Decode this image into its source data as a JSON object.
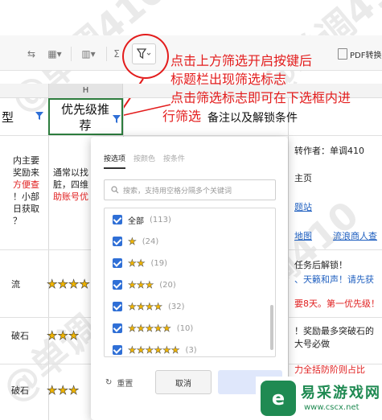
{
  "toolbar": {
    "sigma_label": "Σ",
    "pdf_label": "PDF转换",
    "filter_icon": "filter-funnel-icon"
  },
  "sheet": {
    "column_letter": "H",
    "header_type": "型",
    "header_priority": "优先级推荐",
    "header_notes": "备注以及解锁条件",
    "col_g_rows": [
      "内主要",
      "奖励来",
      "方便查",
      "！小部",
      "日获取",
      "？"
    ],
    "col_h_text": "通常以找",
    "col_h_text2": "脏，四维",
    "col_h_text3": "助账号优",
    "left_labels": [
      "流",
      "破石",
      "破石"
    ],
    "right_author": "转作者：单调410",
    "right_home": "主页",
    "right_site": "题站",
    "right_map": "地图",
    "right_trader": "流浪商人查",
    "right_task": "任务后解锁！",
    "right_tianji": "、天籁和声！请先获",
    "right_ba": "要8天。第一优先级！",
    "right_reward": "！奖励最多突破石的",
    "right_bighao": "大号必做",
    "right_bottom": "力全括防阶则占比"
  },
  "annotation": {
    "line1": "点击上方筛选开启按键后",
    "line2": "标题栏出现筛选标志",
    "line3": "点击筛选标志即可在下选框内进",
    "line4": "行筛选"
  },
  "popup": {
    "tabs": [
      "按选项",
      "按颜色",
      "按条件"
    ],
    "search_placeholder": "搜索，支持用空格分隔多个关键词",
    "items": [
      {
        "label": "全部",
        "count": "(113)",
        "stars": ""
      },
      {
        "label": "",
        "count": "(24)",
        "stars": "★"
      },
      {
        "label": "",
        "count": "(19)",
        "stars": "★★"
      },
      {
        "label": "",
        "count": "(20)",
        "stars": "★★★"
      },
      {
        "label": "",
        "count": "(32)",
        "stars": "★★★★"
      },
      {
        "label": "",
        "count": "(10)",
        "stars": "★★★★★"
      },
      {
        "label": "",
        "count": "(3)",
        "stars": "★★★★★★"
      }
    ],
    "reset_label": "重置",
    "cancel_label": "取消"
  },
  "logo": {
    "name": "易采游戏网",
    "url": "www.cscx.net"
  },
  "watermark": "单调410",
  "colors": {
    "accent_red": "#e31c1c",
    "checkbox_blue": "#2f6fd6",
    "star_gold": "#f0b400",
    "brand_green": "#1f8a52"
  }
}
